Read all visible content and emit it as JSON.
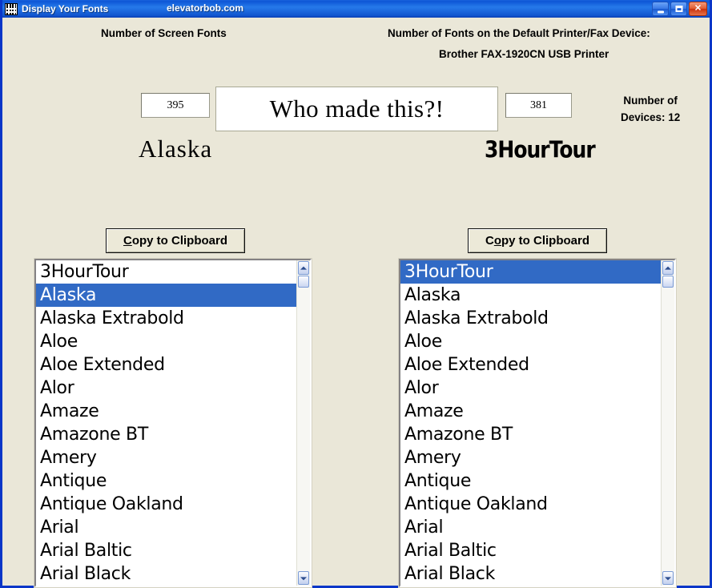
{
  "window": {
    "title": "Display Your Fonts",
    "subtitle": "elevatorbob.com",
    "icon": "font-grid-icon",
    "buttons": {
      "minimize": "minimize-button",
      "maximize": "maximize-button",
      "close": "close-button"
    },
    "accent_color": "#0a56d6",
    "background_color": "#eae7d8",
    "selection_color": "#316ac5"
  },
  "headers": {
    "screen_fonts": "Number of Screen Fonts",
    "printer_fonts": "Number of Fonts on the Default Printer/Fax Device:",
    "printer_name": "Brother FAX-1920CN USB Printer",
    "devices": "Number of\nDevices: 12",
    "devices_line1": "Number of",
    "devices_line2": "Devices: 12"
  },
  "counts": {
    "screen_fonts": "395",
    "printer_fonts": "381",
    "devices": "12"
  },
  "preview": {
    "center_text": "Who made this?!",
    "left_sample": "Alaska",
    "right_sample": "3HourTour"
  },
  "buttons": {
    "copy_left": {
      "before": "",
      "accel": "C",
      "after": "opy to Clipboard"
    },
    "copy_right": {
      "before": "C",
      "accel": "o",
      "after": "py to Clipboard"
    }
  },
  "lists": {
    "left": {
      "selected_index": 1,
      "items": [
        "3HourTour",
        "Alaska",
        "Alaska Extrabold",
        "Aloe",
        "Aloe Extended",
        "Alor",
        "Amaze",
        "Amazone BT",
        "Amery",
        "Antique",
        "Antique Oakland",
        "Arial",
        "Arial Baltic",
        "Arial Black"
      ]
    },
    "right": {
      "selected_index": 0,
      "items": [
        "3HourTour",
        "Alaska",
        "Alaska Extrabold",
        "Aloe",
        "Aloe Extended",
        "Alor",
        "Amaze",
        "Amazone BT",
        "Amery",
        "Antique",
        "Antique Oakland",
        "Arial",
        "Arial Baltic",
        "Arial Black"
      ]
    }
  }
}
